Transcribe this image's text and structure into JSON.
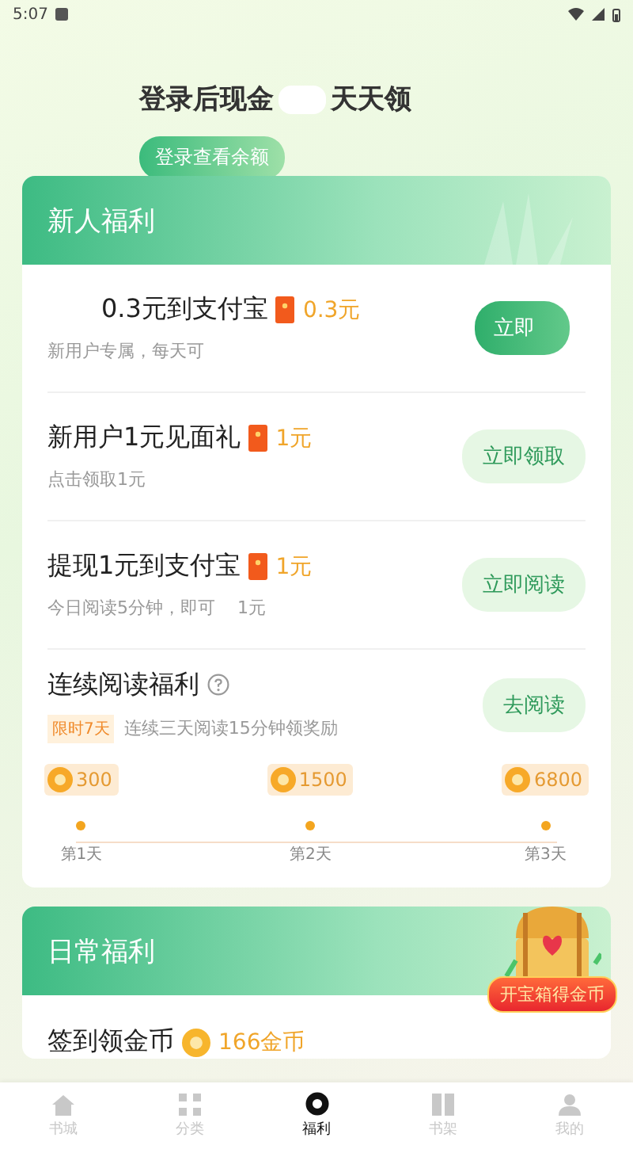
{
  "status_bar": {
    "time": "5:07"
  },
  "header": {
    "title_parts": [
      "登录后现金",
      "天天领"
    ],
    "login_button": "登录查看余额"
  },
  "new_user": {
    "title": "新人福利",
    "tasks": [
      {
        "title": "0.3元到支付宝",
        "reward": "0.3元",
        "subtitle": [
          "新用户专属，每天可"
        ],
        "button": "立即",
        "kind": "primary"
      },
      {
        "title": "新用户1元见面礼",
        "reward": "1元",
        "subtitle": [
          "点击领取1元"
        ],
        "button": "立即领取",
        "kind": "soft"
      },
      {
        "title": "提现1元到支付宝",
        "reward": "1元",
        "subtitle": [
          "今日阅读5分钟，即可",
          "1元"
        ],
        "button": "立即阅读",
        "kind": "soft"
      }
    ],
    "streak": {
      "title": "连续阅读福利",
      "tag": "限时7天",
      "description": "连续三天阅读15分钟领奖励",
      "button": "去阅读",
      "milestones": [
        {
          "coins": "300",
          "day": "第1天"
        },
        {
          "coins": "1500",
          "day": "第2天"
        },
        {
          "coins": "6800",
          "day": "第3天"
        }
      ]
    }
  },
  "daily": {
    "title": "日常福利",
    "chest_label": "开宝箱得金币",
    "tasks": [
      {
        "title": "签到领金币",
        "reward": "166金币"
      }
    ]
  },
  "nav": [
    {
      "label": "书城",
      "selected": false
    },
    {
      "label": "分类",
      "selected": false
    },
    {
      "label": "福利",
      "selected": true
    },
    {
      "label": "书架",
      "selected": false
    },
    {
      "label": "我的",
      "selected": false
    }
  ]
}
